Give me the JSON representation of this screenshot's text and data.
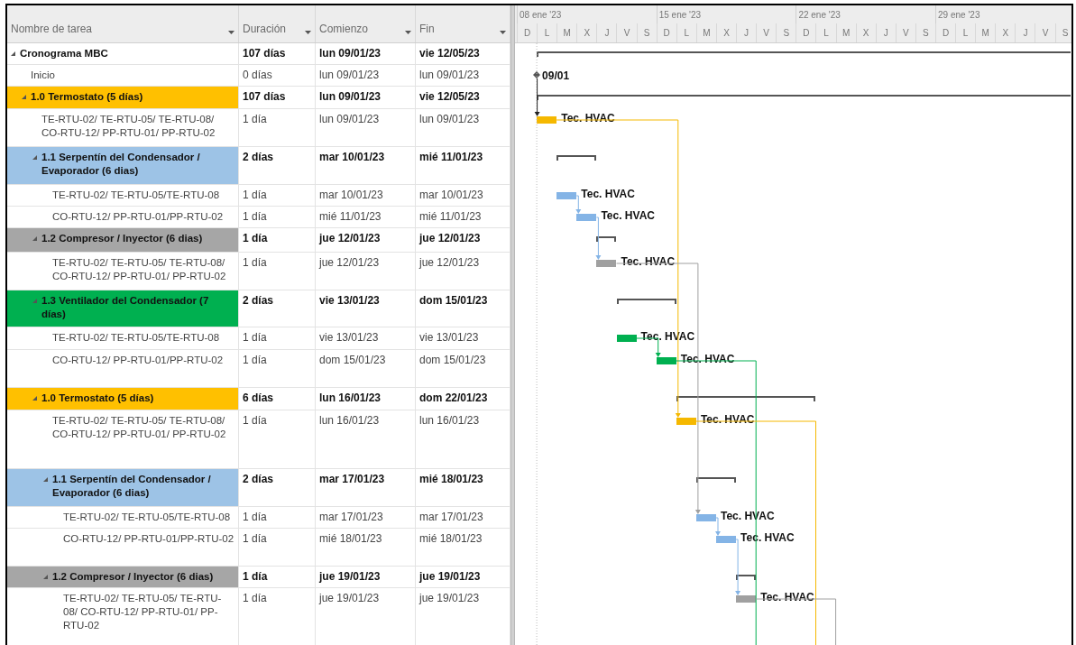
{
  "table": {
    "columns": [
      {
        "label": "Nombre de tarea"
      },
      {
        "label": "Duración"
      },
      {
        "label": "Comienzo"
      },
      {
        "label": "Fin"
      }
    ],
    "tasks": [
      {
        "name": "Cronograma MBC",
        "duration": "107 días",
        "start": "lun 09/01/23",
        "finish": "vie 12/05/23",
        "expanded": true,
        "bar": {
          "kind": "summary"
        },
        "children": [
          {
            "name": "Inicio",
            "duration": "0 días",
            "start": "lun 09/01/23",
            "finish": "lun 09/01/23",
            "bar": {
              "kind": "milestone",
              "label": "09/01"
            }
          },
          {
            "name": "1.0 Termostato (5 días)",
            "duration": "107 días",
            "start": "lun 09/01/23",
            "finish": "vie 12/05/23",
            "expanded": true,
            "color": "#ffc000",
            "bar": {
              "kind": "summary"
            },
            "children": [
              {
                "name": "TE-RTU-02/ TE-RTU-05/ TE-RTU-08/ CO-RTU-12/ PP-RTU-01/ PP-RTU-02",
                "duration": "1 día",
                "start": "lun 09/01/23",
                "finish": "lun 09/01/23",
                "bar": {
                  "kind": "task",
                  "label": "Tec. HVAC",
                  "color": "#f5b800"
                }
              },
              {
                "name": "1.1 Serpentín del Condensador / Evaporador (6 dias)",
                "duration": "2 días",
                "start": "mar 10/01/23",
                "finish": "mié 11/01/23",
                "expanded": true,
                "color": "#9dc3e6",
                "bar": {
                  "kind": "summary"
                },
                "children": [
                  {
                    "name": "TE-RTU-02/ TE-RTU-05/TE-RTU-08",
                    "duration": "1 día",
                    "start": "mar 10/01/23",
                    "finish": "mar 10/01/23",
                    "bar": {
                      "kind": "task",
                      "label": "Tec. HVAC",
                      "color": "#84b4e6"
                    }
                  },
                  {
                    "name": "CO-RTU-12/ PP-RTU-01/PP-RTU-02",
                    "duration": "1 día",
                    "start": "mié 11/01/23",
                    "finish": "mié 11/01/23",
                    "bar": {
                      "kind": "task",
                      "label": "Tec. HVAC",
                      "color": "#84b4e6"
                    }
                  }
                ]
              },
              {
                "name": "1.2 Compresor / Inyector  (6 dias)",
                "duration": "1 día",
                "start": "jue 12/01/23",
                "finish": "jue 12/01/23",
                "expanded": true,
                "color": "#a6a6a6",
                "bar": {
                  "kind": "summary"
                },
                "children": [
                  {
                    "name": "TE-RTU-02/ TE-RTU-05/ TE-RTU-08/ CO-RTU-12/ PP-RTU-01/ PP-RTU-02",
                    "duration": "1 día",
                    "start": "jue 12/01/23",
                    "finish": "jue 12/01/23",
                    "bar": {
                      "kind": "task",
                      "label": "Tec. HVAC",
                      "color": "#a0a0a0"
                    }
                  }
                ]
              },
              {
                "name": "1.3 Ventilador del Condensador  (7 días)",
                "duration": "2 días",
                "start": "vie 13/01/23",
                "finish": "dom 15/01/23",
                "expanded": true,
                "color": "#00b050",
                "bar": {
                  "kind": "summary"
                },
                "children": [
                  {
                    "name": "TE-RTU-02/ TE-RTU-05/TE-RTU-08",
                    "duration": "1 día",
                    "start": "vie 13/01/23",
                    "finish": "vie 13/01/23",
                    "bar": {
                      "kind": "task",
                      "label": "Tec. HVAC",
                      "color": "#00b050"
                    }
                  },
                  {
                    "name": "CO-RTU-12/ PP-RTU-01/PP-RTU-02",
                    "duration": "1 día",
                    "start": "dom 15/01/23",
                    "finish": "dom 15/01/23",
                    "bar": {
                      "kind": "task",
                      "label": "Tec. HVAC",
                      "color": "#00b050"
                    }
                  }
                ]
              },
              {
                "name": "1.0 Termostato (5 días)",
                "duration": "6 días",
                "start": "lun 16/01/23",
                "finish": "dom 22/01/23",
                "expanded": true,
                "color": "#ffc000",
                "bar": {
                  "kind": "summary"
                },
                "children": [
                  {
                    "name": "TE-RTU-02/ TE-RTU-05/ TE-RTU-08/ CO-RTU-12/ PP-RTU-01/ PP-RTU-02",
                    "duration": "1 día",
                    "start": "lun 16/01/23",
                    "finish": "lun 16/01/23",
                    "bar": {
                      "kind": "task",
                      "label": "Tec. HVAC",
                      "color": "#f5b800"
                    }
                  },
                  {
                    "name": "1.1 Serpentín del Condensador / Evaporador (6 dias)",
                    "duration": "2 días",
                    "start": "mar 17/01/23",
                    "finish": "mié 18/01/23",
                    "expanded": true,
                    "color": "#9dc3e6",
                    "bar": {
                      "kind": "summary"
                    },
                    "children": [
                      {
                        "name": "TE-RTU-02/ TE-RTU-05/TE-RTU-08",
                        "duration": "1 día",
                        "start": "mar 17/01/23",
                        "finish": "mar 17/01/23",
                        "bar": {
                          "kind": "task",
                          "label": "Tec. HVAC",
                          "color": "#84b4e6"
                        }
                      },
                      {
                        "name": "CO-RTU-12/ PP-RTU-01/PP-RTU-02",
                        "duration": "1 día",
                        "start": "mié 18/01/23",
                        "finish": "mié 18/01/23",
                        "bar": {
                          "kind": "task",
                          "label": "Tec. HVAC",
                          "color": "#84b4e6"
                        }
                      }
                    ]
                  },
                  {
                    "name": "1.2 Compresor / Inyector  (6 dias)",
                    "duration": "1 día",
                    "start": "jue 19/01/23",
                    "finish": "jue 19/01/23",
                    "expanded": true,
                    "color": "#a6a6a6",
                    "bar": {
                      "kind": "summary"
                    },
                    "children": [
                      {
                        "name": "TE-RTU-02/ TE-RTU-05/ TE-RTU-08/ CO-RTU-12/ PP-RTU-01/ PP-RTU-02",
                        "duration": "1 día",
                        "start": "jue 19/01/23",
                        "finish": "jue 19/01/23",
                        "bar": {
                          "kind": "task",
                          "label": "Tec. HVAC",
                          "color": "#a0a0a0"
                        }
                      }
                    ]
                  }
                ]
              }
            ]
          }
        ]
      }
    ]
  },
  "timescale": {
    "weeks": [
      "08 ene '23",
      "15 ene '23",
      "22 ene '23",
      "29 ene '23"
    ],
    "days": [
      "D",
      "L",
      "M",
      "X",
      "J",
      "V",
      "S",
      "D",
      "L",
      "M",
      "X",
      "J",
      "V",
      "S",
      "D",
      "L",
      "M",
      "X",
      "J",
      "V",
      "S",
      "D",
      "L",
      "M",
      "X",
      "J",
      "V",
      "S"
    ]
  }
}
